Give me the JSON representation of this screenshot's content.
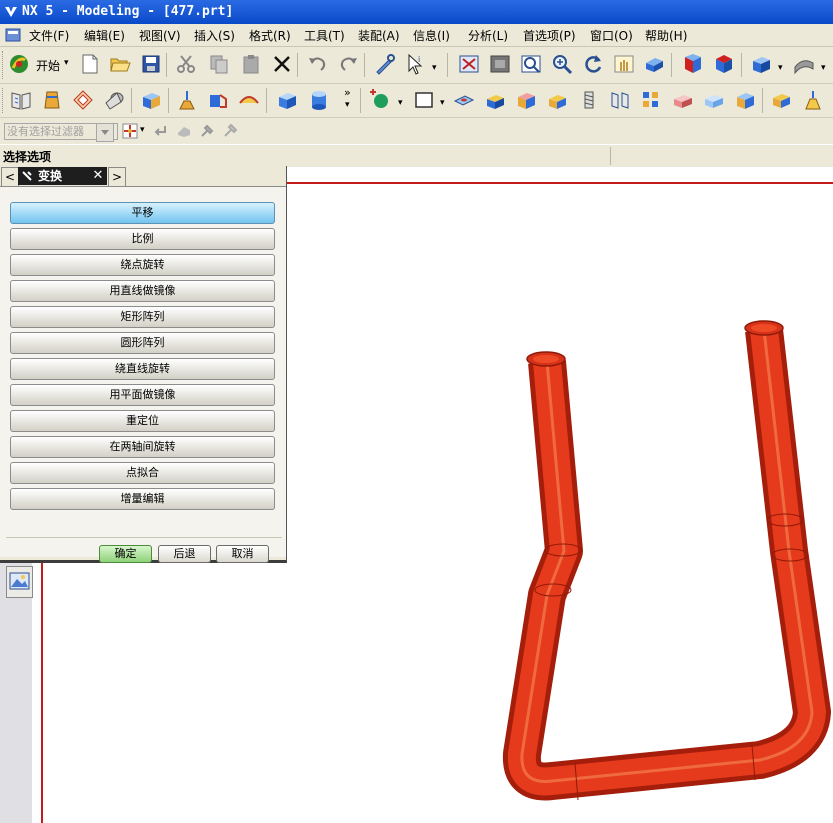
{
  "window": {
    "title": "NX 5 - Modeling - [477.prt]"
  },
  "menu": [
    "文件(F)",
    "编辑(E)",
    "视图(V)",
    "插入(S)",
    "格式(R)",
    "工具(T)",
    "装配(A)",
    "信息(I)",
    "分析(L)",
    "首选项(P)",
    "窗口(O)",
    "帮助(H)"
  ],
  "toolbar": {
    "start_label": "开始"
  },
  "selection": {
    "filter_placeholder": "没有选择过滤器"
  },
  "cue_line": "选择选项",
  "dialog": {
    "title": "变换",
    "options": [
      "平移",
      "比例",
      "绕点旋转",
      "用直线做镜像",
      "矩形阵列",
      "圆形阵列",
      "绕直线旋转",
      "用平面做镜像",
      "重定位",
      "在两轴间旋转",
      "点拟合",
      "增量编辑"
    ],
    "selected_option": "平移",
    "ok_label": "确定",
    "back_label": "后退",
    "cancel_label": "取消"
  },
  "colors": {
    "title_bar": "#0a49c8",
    "pipe": "#e63a1c",
    "selected_option": "#9fd9f7",
    "ok_button": "#8ed27a"
  },
  "icons": [
    "nx-logo-icon",
    "start-icon",
    "new-icon",
    "open-icon",
    "save-icon",
    "cut-icon",
    "copy-icon",
    "paste-icon",
    "delete-icon",
    "undo-icon",
    "redo-icon",
    "fit-icon",
    "zoom-icon",
    "rotate-icon",
    "block-icon",
    "cylinder-icon",
    "sketch-icon",
    "image-icon"
  ]
}
